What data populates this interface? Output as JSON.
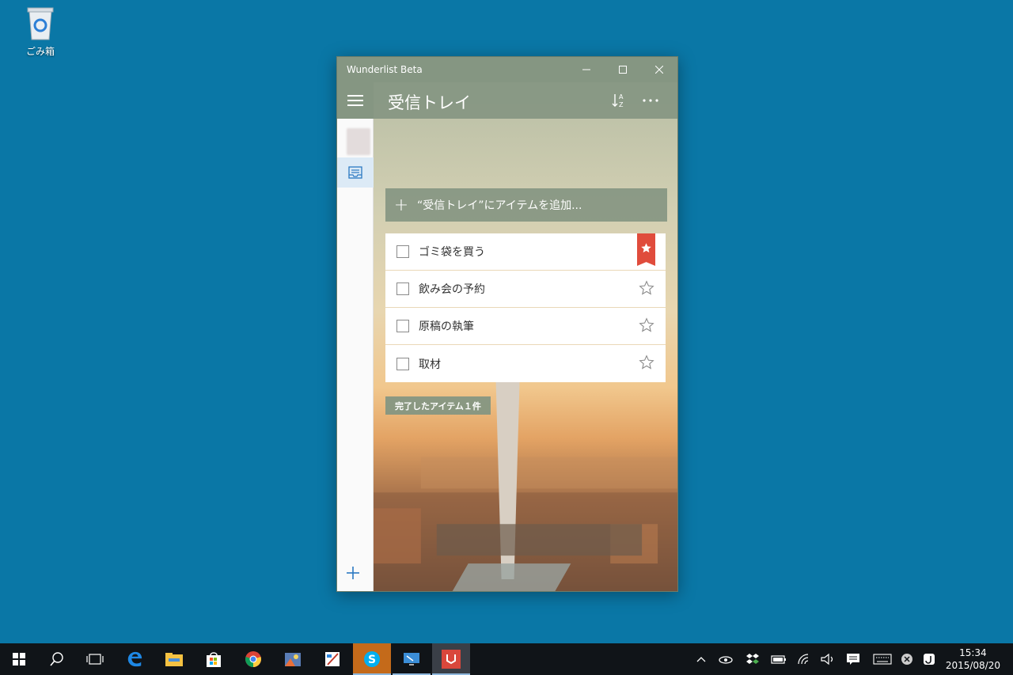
{
  "desktop": {
    "recycle_bin_label": "ごみ箱"
  },
  "window": {
    "title": "Wunderlist Beta",
    "list_title": "受信トレイ",
    "add_placeholder": "“受信トレイ”にアイテムを追加...",
    "tasks": [
      {
        "text": "ゴミ袋を買う",
        "starred": true
      },
      {
        "text": "飲み会の予約",
        "starred": false
      },
      {
        "text": "原稿の執筆",
        "starred": false
      },
      {
        "text": "取材",
        "starred": false
      }
    ],
    "completed_label": "完了したアイテム１件",
    "accent_color": "#859682",
    "star_color": "#e04c3c"
  },
  "taskbar": {
    "apps": [
      "start-icon",
      "search-icon",
      "task-view-icon",
      "edge-icon",
      "file-explorer-icon",
      "store-icon",
      "chrome-icon",
      "photos-icon",
      "paint-icon",
      "skype-icon",
      "remote-desktop-icon",
      "wunderlist-icon"
    ],
    "clock_time": "15:34",
    "clock_date": "2015/08/20"
  }
}
